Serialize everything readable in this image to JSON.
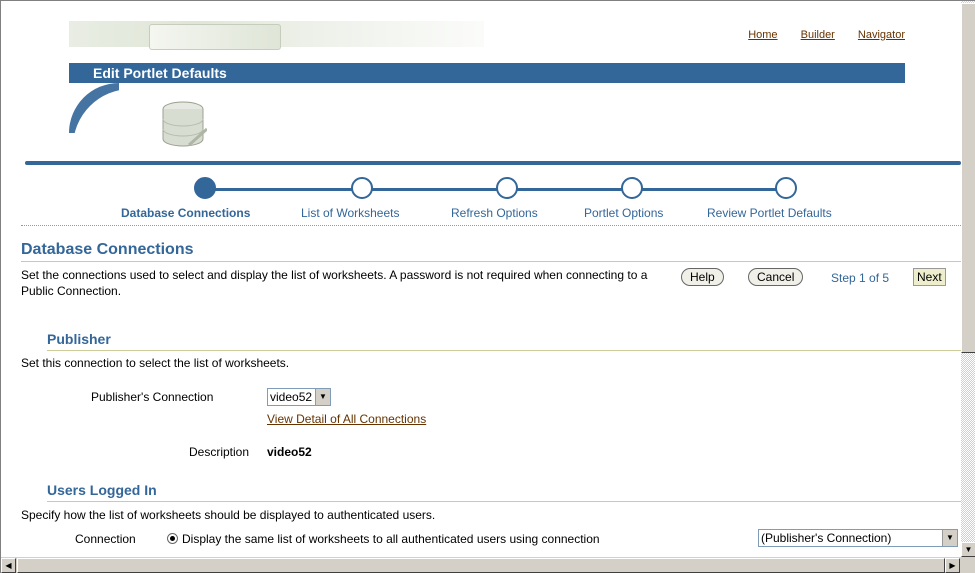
{
  "header": {
    "links": [
      "Home",
      "Builder",
      "Navigator"
    ],
    "title": "Edit Portlet Defaults"
  },
  "train": {
    "steps": [
      "Database Connections",
      "List of Worksheets",
      "Refresh Options",
      "Portlet Options",
      "Review Portlet Defaults"
    ],
    "active_index": 0
  },
  "section": {
    "title": "Database Connections",
    "description": "Set the connections used to select and display the list of worksheets. A password is not required when connecting to a Public Connection."
  },
  "buttons": {
    "help": "Help",
    "cancel": "Cancel",
    "step_text": "Step 1 of 5",
    "next": "Next"
  },
  "publisher": {
    "title": "Publisher",
    "instructions": "Set this connection to select the list of worksheets.",
    "connection_label": "Publisher's Connection",
    "connection_value": "video52 *",
    "view_link": "View Detail of All Connections",
    "description_label": "Description",
    "description_value": "video52"
  },
  "users": {
    "title": "Users Logged In",
    "instructions": "Specify how the list of worksheets should be displayed to authenticated users.",
    "connection_label": "Connection",
    "radio_label": "Display the same list of worksheets to all authenticated users using connection",
    "select_value": "(Publisher's Connection)"
  },
  "colors": {
    "accent": "#336699",
    "link": "#663300"
  }
}
